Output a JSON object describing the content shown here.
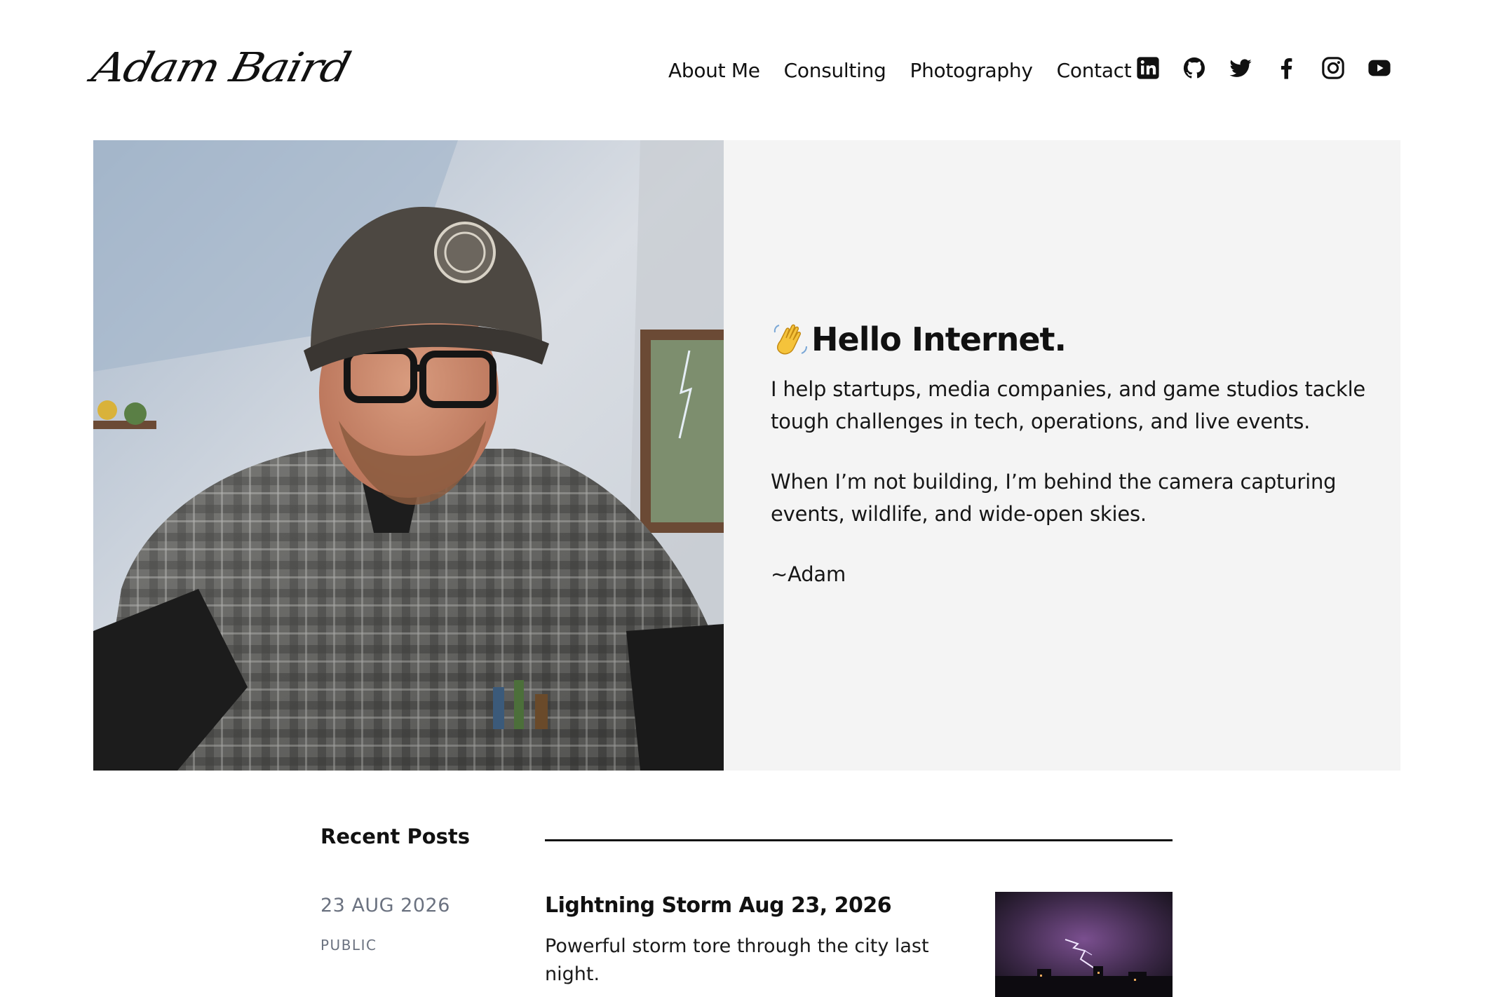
{
  "header": {
    "logo_text": "Adam Baird",
    "nav": [
      "About Me",
      "Consulting",
      "Photography",
      "Contact"
    ],
    "social_icons": [
      "linkedin-icon",
      "github-icon",
      "twitter-icon",
      "facebook-icon",
      "instagram-icon",
      "youtube-icon"
    ]
  },
  "hero": {
    "title": "Hello Internet.",
    "paragraphs": [
      "I help startups, media companies, and game studios tackle tough challenges in tech, operations, and live events.",
      "When I’m not building, I’m behind the camera capturing events, wildlife, and wide-open skies.",
      "~Adam"
    ]
  },
  "recent_posts": {
    "label": "Recent Posts",
    "posts": [
      {
        "date": "23 AUG 2026",
        "visibility": "PUBLIC",
        "title": "Lightning Storm Aug 23, 2026",
        "excerpt": "Powerful storm tore through the city last night."
      }
    ]
  },
  "colors": {
    "text": "#111111",
    "muted": "#6b7280",
    "hero_bg": "#f4f4f4",
    "wave_emoji": "#f5c33b"
  }
}
